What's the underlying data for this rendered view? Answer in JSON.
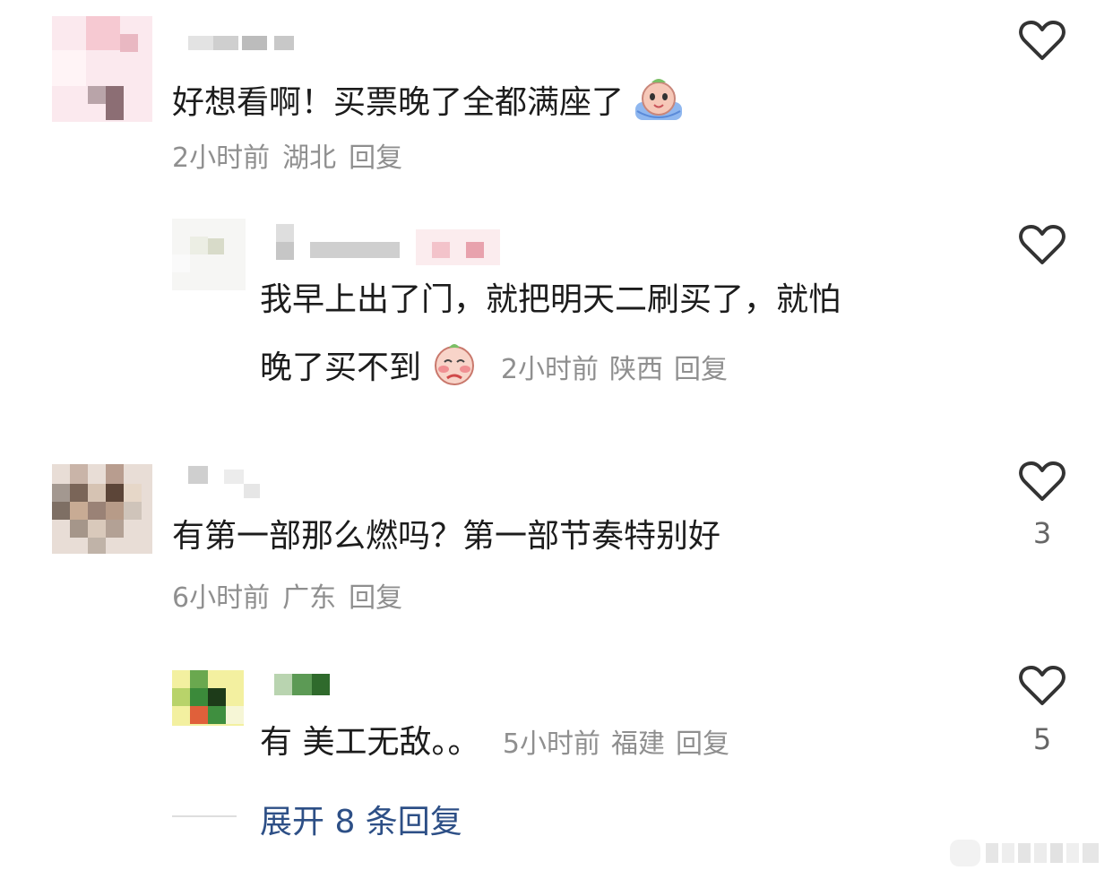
{
  "comments": [
    {
      "text": "好想看啊！买票晚了全都满座了",
      "emoji": "crying-face-emoji",
      "time": "2小时前",
      "location": "湖北",
      "reply": "回复",
      "likes": ""
    },
    {
      "text_line1": "我早上出了门，就把明天二刷买了，就怕",
      "text_line2": "晚了买不到",
      "emoji": "shy-face-emoji",
      "time": "2小时前",
      "location": "陕西",
      "reply": "回复",
      "likes": ""
    },
    {
      "text": "有第一部那么燃吗？第一部节奏特别好",
      "time": "6小时前",
      "location": "广东",
      "reply": "回复",
      "likes": "3"
    },
    {
      "text": "有 美工无敌。。",
      "time": "5小时前",
      "location": "福建",
      "reply": "回复",
      "likes": "5"
    }
  ],
  "expand_replies": "展开 8 条回复",
  "colors": {
    "text": "#1c1c1c",
    "meta": "#8f8f8f",
    "link": "#2d4f86",
    "heart": "#333333"
  }
}
